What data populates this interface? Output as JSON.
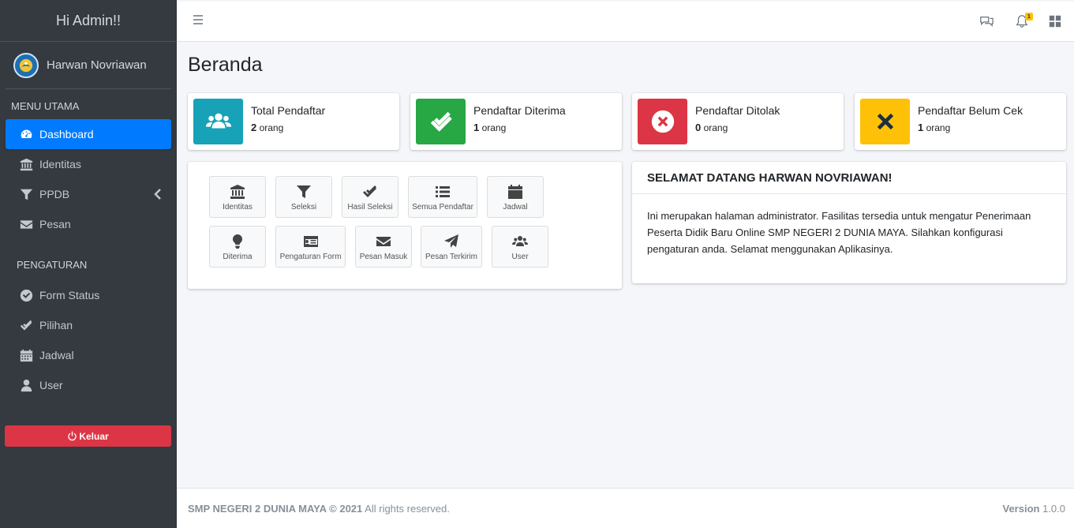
{
  "sidebar": {
    "brand": "Hi Admin!!",
    "user_name": "Harwan Novriawan",
    "header_main": "MENU UTAMA",
    "header_settings": "PENGATURAN",
    "main_items": [
      {
        "label": "Dashboard",
        "icon": "tachometer-icon"
      },
      {
        "label": "Identitas",
        "icon": "bank-icon"
      },
      {
        "label": "PPDB",
        "icon": "filter-icon"
      },
      {
        "label": "Pesan",
        "icon": "envelope-icon"
      }
    ],
    "settings_items": [
      {
        "label": "Form Status",
        "icon": "check-circle-icon"
      },
      {
        "label": "Pilihan",
        "icon": "check-double-icon"
      },
      {
        "label": "Jadwal",
        "icon": "calendar-icon"
      },
      {
        "label": "User",
        "icon": "user-icon"
      }
    ],
    "logout_label": "Keluar"
  },
  "topbar": {
    "notification_count": "1"
  },
  "page": {
    "title": "Beranda"
  },
  "info_boxes": [
    {
      "label": "Total Pendaftar",
      "count": "2",
      "unit": "orang",
      "color": "#17a2b8"
    },
    {
      "label": "Pendaftar Diterima",
      "count": "1",
      "unit": "orang",
      "color": "#28a745"
    },
    {
      "label": "Pendaftar Ditolak",
      "count": "0",
      "unit": "orang",
      "color": "#dc3545"
    },
    {
      "label": "Pendaftar Belum Cek",
      "count": "1",
      "unit": "orang",
      "color": "#ffc107"
    }
  ],
  "quick_links": [
    {
      "label": "Identitas",
      "icon": "bank-icon"
    },
    {
      "label": "Seleksi",
      "icon": "filter-icon"
    },
    {
      "label": "Hasil Seleksi",
      "icon": "check-double-icon"
    },
    {
      "label": "Semua Pendaftar",
      "icon": "list-icon"
    },
    {
      "label": "Jadwal",
      "icon": "calendar-icon"
    },
    {
      "label": "Diterima",
      "icon": "lightbulb-icon"
    },
    {
      "label": "Pengaturan Form",
      "icon": "id-card-icon"
    },
    {
      "label": "Pesan Masuk",
      "icon": "envelope-icon"
    },
    {
      "label": "Pesan Terkirim",
      "icon": "paper-plane-icon"
    },
    {
      "label": "User",
      "icon": "users-icon"
    }
  ],
  "welcome": {
    "title": "SELAMAT DATANG HARWAN NOVRIAWAN!",
    "text": "Ini merupakan halaman administrator. Fasilitas tersedia untuk mengatur Penerimaan Peserta Didik Baru Online SMP NEGERI 2 DUNIA MAYA. Silahkan konfigurasi pengaturan anda. Selamat menggunakan Aplikasinya."
  },
  "footer": {
    "copyright_bold": "SMP NEGERI 2 DUNIA MAYA © 2021",
    "copyright_rest": " All rights reserved.",
    "version_label": "Version",
    "version_value": " 1.0.0"
  }
}
